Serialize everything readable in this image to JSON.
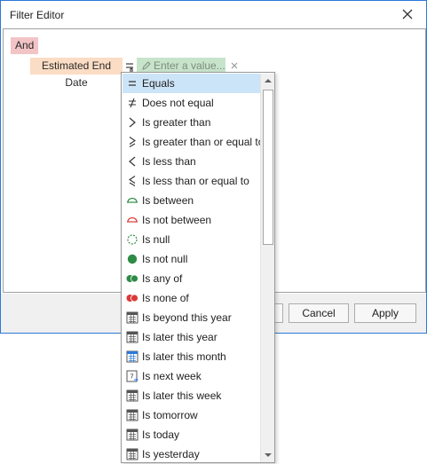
{
  "window": {
    "title": "Filter Editor"
  },
  "filter": {
    "group_operator": "And",
    "field": "Estimated End Date",
    "value_placeholder": "Enter a value..."
  },
  "footer": {
    "cancel_label": "Cancel",
    "apply_label": "Apply"
  },
  "operators": [
    {
      "label": "Equals",
      "icon": "equals-icon",
      "selected": true
    },
    {
      "label": "Does not equal",
      "icon": "not-equal-icon"
    },
    {
      "label": "Is greater than",
      "icon": "greater-than-icon"
    },
    {
      "label": "Is greater than or equal to",
      "icon": "greater-or-equal-icon"
    },
    {
      "label": "Is less than",
      "icon": "less-than-icon"
    },
    {
      "label": "Is less than or equal to",
      "icon": "less-or-equal-icon"
    },
    {
      "label": "Is between",
      "icon": "between-icon"
    },
    {
      "label": "Is not between",
      "icon": "not-between-icon"
    },
    {
      "label": "Is null",
      "icon": "null-icon"
    },
    {
      "label": "Is not null",
      "icon": "not-null-icon"
    },
    {
      "label": "Is any of",
      "icon": "any-of-icon"
    },
    {
      "label": "Is none of",
      "icon": "none-of-icon"
    },
    {
      "label": "Is beyond this year",
      "icon": "calendar-icon"
    },
    {
      "label": "Is later this year",
      "icon": "calendar-icon"
    },
    {
      "label": "Is later this month",
      "icon": "calendar-month-icon"
    },
    {
      "label": "Is next week",
      "icon": "calendar-day-icon"
    },
    {
      "label": "Is later this week",
      "icon": "calendar-icon"
    },
    {
      "label": "Is tomorrow",
      "icon": "calendar-icon"
    },
    {
      "label": "Is today",
      "icon": "calendar-icon"
    },
    {
      "label": "Is yesterday",
      "icon": "calendar-icon"
    }
  ],
  "colors": {
    "group_node": "#f2c4c6",
    "field_node": "#fbdcc4",
    "value_node": "#c7e4ca",
    "selection": "#cce4f7",
    "green": "#2e8b46",
    "red": "#d93a3a"
  }
}
